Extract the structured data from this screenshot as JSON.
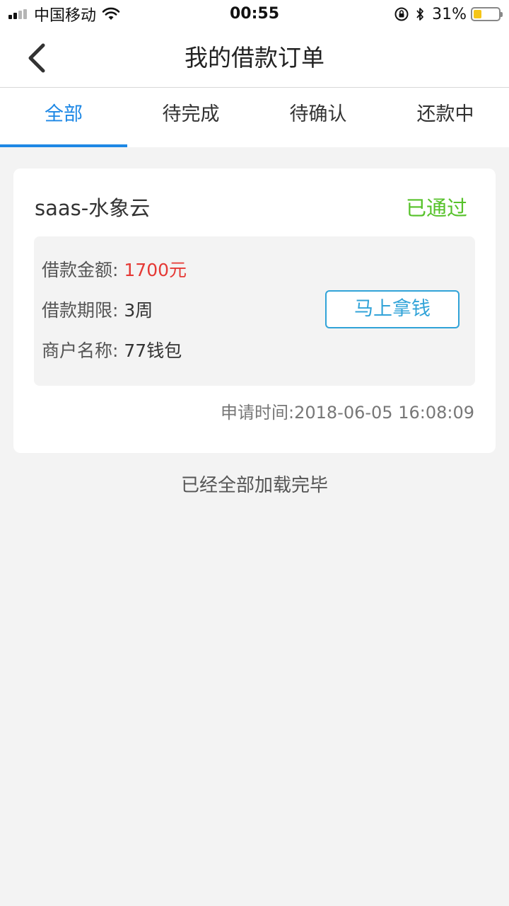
{
  "status_bar": {
    "carrier": "中国移动",
    "time": "00:55",
    "battery_percent": "31%",
    "battery_level": 0.31,
    "signal_bars": 4,
    "signal_active": 2,
    "icons": [
      "signal-icon",
      "wifi-icon",
      "rotation-lock-icon",
      "bluetooth-icon",
      "battery-icon"
    ]
  },
  "nav": {
    "title": "我的借款订单",
    "back_icon": "chevron-left-icon"
  },
  "tabs": [
    {
      "label": "全部",
      "active": true
    },
    {
      "label": "待完成",
      "active": false
    },
    {
      "label": "待确认",
      "active": false
    },
    {
      "label": "还款中",
      "active": false
    }
  ],
  "order": {
    "merchant": "saas-水象云",
    "status": "已通过",
    "amount_label": "借款金额:",
    "amount_value": "1700元",
    "term_label": "借款期限:",
    "term_value": "3周",
    "shop_label": "商户名称:",
    "shop_value": "77钱包",
    "action_label": "马上拿钱",
    "apply_time": "申请时间:2018-06-05 16:08:09"
  },
  "footer": {
    "note": "已经全部加载完毕"
  },
  "colors": {
    "accent": "#1e88e5",
    "status_ok": "#56c22a",
    "amount": "#e53935",
    "button": "#31a3d8",
    "background": "#f3f3f3"
  }
}
